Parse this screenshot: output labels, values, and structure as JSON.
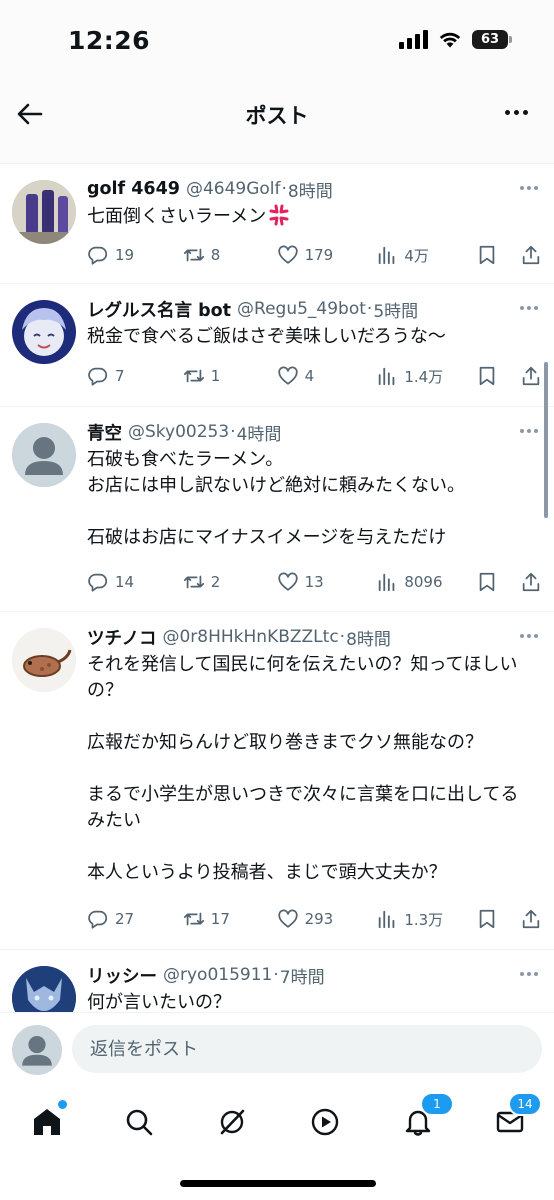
{
  "status": {
    "time": "12:26",
    "battery": "63"
  },
  "header": {
    "title": "ポスト"
  },
  "tweets": [
    {
      "name": "golf 4649",
      "handle": "@4649Golf",
      "time": "8時間",
      "text": "七面倒くさいラーメン",
      "emoji": "anger-icon",
      "replies": "19",
      "reposts": "8",
      "likes": "179",
      "views": "4万"
    },
    {
      "name": "レグルス名言 bot",
      "handle": "@Regu5_49bot",
      "time": "5時間",
      "text": "税金で食べるご飯はさぞ美味しいだろうな〜",
      "replies": "7",
      "reposts": "1",
      "likes": "4",
      "views": "1.4万"
    },
    {
      "name": "青空",
      "handle": "@Sky00253",
      "time": "4時間",
      "text": "石破も食べたラーメン。\nお店には申し訳ないけど絶対に頼みたくない。\n\n石破はお店にマイナスイメージを与えただけ",
      "replies": "14",
      "reposts": "2",
      "likes": "13",
      "views": "8096"
    },
    {
      "name": "ツチノコ",
      "handle": "@0r8HHkHnKBZZLtc",
      "time": "8時間",
      "text": "それを発信して国民に何を伝えたいの？知ってほしいの？\n\n広報だか知らんけど取り巻きまでクソ無能なの？\n\nまるで小学生が思いつきで次々に言葉を口に出してるみたい\n\n本人というより投稿者、まじで頭大丈夫か？",
      "replies": "27",
      "reposts": "17",
      "likes": "293",
      "views": "1.3万"
    },
    {
      "name": "リッシー",
      "handle": "@ryo015911",
      "time": "7時間",
      "text": "何が言いたいの？"
    }
  ],
  "reply": {
    "placeholder": "返信をポスト"
  },
  "tabs": {
    "home_dot": true,
    "notifications_badge": "1",
    "messages_badge": "14"
  },
  "colors": {
    "accent": "#1d9bf0",
    "secondary_text": "#536471",
    "divider": "#eff3f4"
  }
}
